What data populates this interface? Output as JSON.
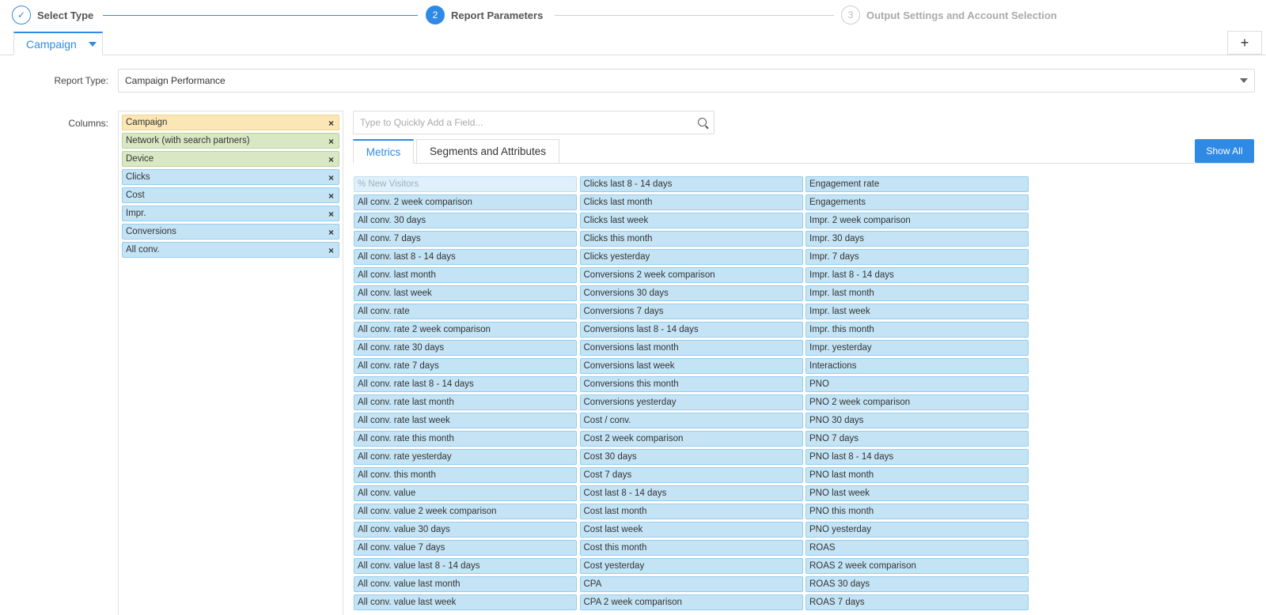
{
  "stepper": {
    "steps": [
      {
        "number": "✓",
        "label": "Select Type"
      },
      {
        "number": "2",
        "label": "Report Parameters"
      },
      {
        "number": "3",
        "label": "Output Settings and Account Selection"
      }
    ]
  },
  "tabs": {
    "active_label": "Campaign",
    "add_label": "+"
  },
  "form": {
    "report_type_label": "Report Type:",
    "report_type_value": "Campaign Performance",
    "columns_label": "Columns:"
  },
  "selected_columns": [
    {
      "label": "Campaign",
      "color": "#fbe7b6"
    },
    {
      "label": "Network (with search partners)",
      "color": "#d8e8c4"
    },
    {
      "label": "Device",
      "color": "#d8e8c4"
    },
    {
      "label": "Clicks",
      "color": "#c4e4f6"
    },
    {
      "label": "Cost",
      "color": "#c4e4f6"
    },
    {
      "label": "Impr.",
      "color": "#c4e4f6"
    },
    {
      "label": "Conversions",
      "color": "#c4e4f6"
    },
    {
      "label": "All conv.",
      "color": "#c4e4f6"
    }
  ],
  "remove_glyph": "×",
  "search": {
    "placeholder": "Type to Quickly Add a Field..."
  },
  "field_tabs": {
    "metrics": "Metrics",
    "segments": "Segments and Attributes",
    "show_all": "Show All"
  },
  "metrics": {
    "col1": [
      "% New Visitors",
      "All conv. 2 week comparison",
      "All conv. 30 days",
      "All conv. 7 days",
      "All conv. last 8 - 14 days",
      "All conv. last month",
      "All conv. last week",
      "All conv. rate",
      "All conv. rate 2 week comparison",
      "All conv. rate 30 days",
      "All conv. rate 7 days",
      "All conv. rate last 8 - 14 days",
      "All conv. rate last month",
      "All conv. rate last week",
      "All conv. rate this month",
      "All conv. rate yesterday",
      "All conv. this month",
      "All conv. value",
      "All conv. value 2 week comparison",
      "All conv. value 30 days",
      "All conv. value 7 days",
      "All conv. value last 8 - 14 days",
      "All conv. value last month",
      "All conv. value last week"
    ],
    "col2": [
      "Clicks last 8 - 14 days",
      "Clicks last month",
      "Clicks last week",
      "Clicks this month",
      "Clicks yesterday",
      "Conversions 2 week comparison",
      "Conversions 30 days",
      "Conversions 7 days",
      "Conversions last 8 - 14 days",
      "Conversions last month",
      "Conversions last week",
      "Conversions this month",
      "Conversions yesterday",
      "Cost / conv.",
      "Cost 2 week comparison",
      "Cost 30 days",
      "Cost 7 days",
      "Cost last 8 - 14 days",
      "Cost last month",
      "Cost last week",
      "Cost this month",
      "Cost yesterday",
      "CPA",
      "CPA 2 week comparison"
    ],
    "col3": [
      "Engagement rate",
      "Engagements",
      "Impr. 2 week comparison",
      "Impr. 30 days",
      "Impr. 7 days",
      "Impr. last 8 - 14 days",
      "Impr. last month",
      "Impr. last week",
      "Impr. this month",
      "Impr. yesterday",
      "Interactions",
      "PNO",
      "PNO 2 week comparison",
      "PNO 30 days",
      "PNO 7 days",
      "PNO last 8 - 14 days",
      "PNO last month",
      "PNO last week",
      "PNO this month",
      "PNO yesterday",
      "ROAS",
      "ROAS 2 week comparison",
      "ROAS 30 days",
      "ROAS 7 days"
    ]
  },
  "colors": {
    "accent": "#2f8ae6",
    "metric_chip": "#c4e4f6"
  }
}
